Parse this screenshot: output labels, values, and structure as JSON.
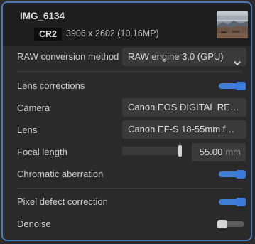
{
  "header": {
    "filename": "IMG_6134",
    "format_badge": "CR2",
    "dimensions": "3906 x 2602 (10.16MP)"
  },
  "raw_conversion": {
    "label": "RAW conversion method",
    "value": "RAW engine 3.0 (GPU)"
  },
  "lens_corrections": {
    "label": "Lens corrections",
    "enabled": true
  },
  "camera": {
    "label": "Camera",
    "value": "Canon EOS DIGITAL REB…"
  },
  "lens": {
    "label": "Lens",
    "value": "Canon EF-S 18-55mm f…"
  },
  "focal_length": {
    "label": "Focal length",
    "value": "55.00",
    "unit": "mm",
    "slider_fraction": 1.0
  },
  "chromatic_aberration": {
    "label": "Chromatic aberration",
    "enabled": true
  },
  "pixel_defect": {
    "label": "Pixel defect correction",
    "enabled": true
  },
  "denoise": {
    "label": "Denoise",
    "enabled": false
  },
  "colors": {
    "accent": "#3f7fd8",
    "panel_border": "#4a78b8",
    "background": "#2a2a2a"
  }
}
